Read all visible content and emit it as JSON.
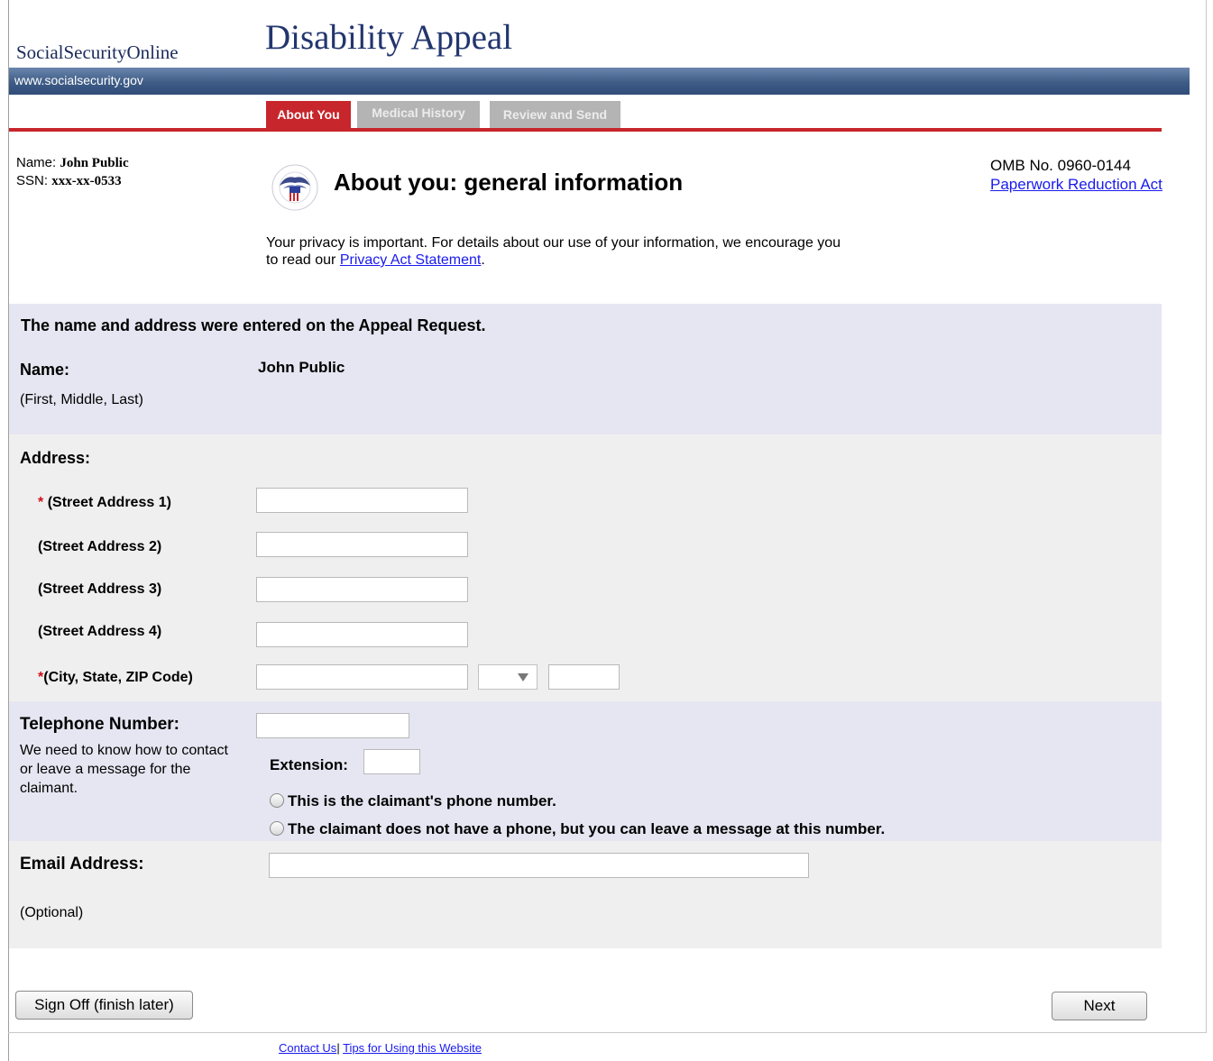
{
  "header": {
    "site_name": "SocialSecurityOnline",
    "app_title": "Disability Appeal",
    "url": "www.socialsecurity.gov"
  },
  "tabs": [
    {
      "label": "About You",
      "state": "active"
    },
    {
      "label": "Medical History",
      "state": "disabled"
    },
    {
      "label": "Review and Send",
      "state": "disabled"
    }
  ],
  "claimant": {
    "name_label": "Name:",
    "name_value": "John Public",
    "ssn_label": "SSN:",
    "ssn_value": "xxx-xx-0533"
  },
  "page": {
    "title": "About you: general information",
    "seal_icon": "ssa-seal-icon",
    "omb_number": "OMB No. 0960-0144",
    "paperwork_link": "Paperwork Reduction Act",
    "privacy_text": "Your privacy is important. For details about our use of your information, we encourage you to read our",
    "privacy_link": "Privacy Act Statement",
    "privacy_end": "."
  },
  "name_section": {
    "heading": "The name and address were entered on the Appeal Request.",
    "label": "Name:",
    "sublabel": "(First, Middle, Last)",
    "value": "John Public"
  },
  "address": {
    "label": "Address:",
    "street1_label": "(Street Address 1)",
    "street2_label": "(Street Address 2)",
    "street3_label": "(Street Address 3)",
    "street4_label": "(Street Address 4)",
    "city_label": "(City, State, ZIP Code)",
    "required_mark": "*",
    "street1_value": "",
    "street2_value": "",
    "street3_value": "",
    "street4_value": "",
    "city_value": "",
    "state_value": "",
    "zip_value": ""
  },
  "phone": {
    "label": "Telephone Number:",
    "help": "We need to know how to contact or leave a message for the claimant.",
    "extension_label": "Extension:",
    "value": "",
    "extension_value": "",
    "option_own": "This is the claimant's phone number.",
    "option_message": "The claimant does not have a phone, but you can leave a message at this number."
  },
  "email": {
    "label": "Email Address:",
    "optional": "(Optional)",
    "value": ""
  },
  "buttons": {
    "sign_off": "Sign Off (finish later)",
    "next": "Next"
  },
  "footer": {
    "contact": "Contact Us",
    "separator": "|",
    "tips": "Tips for Using this Website"
  },
  "colors": {
    "active_tab": "#c7262c",
    "header_bar": "#3e5c86",
    "lavender_band": "#e6e6f2",
    "gray_band": "#efefef",
    "link": "#1a1aee"
  }
}
